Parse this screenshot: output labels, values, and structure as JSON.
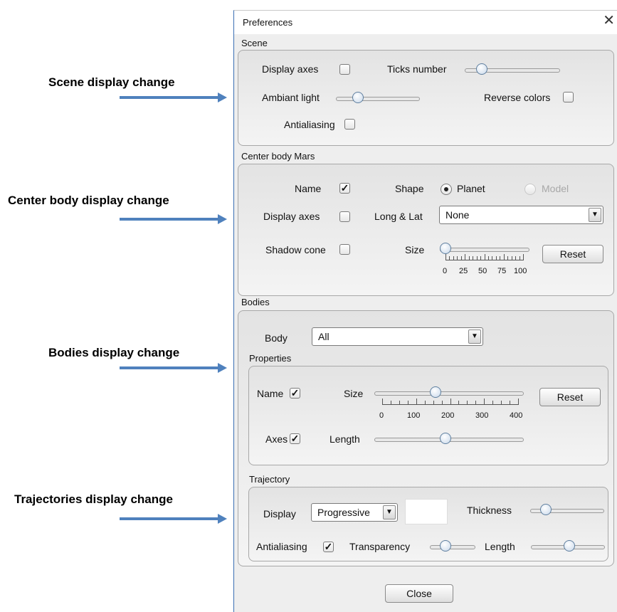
{
  "annotations": {
    "scene": "Scene display change",
    "center_body": "Center body display change",
    "bodies": "Bodies display change",
    "trajectories": "Trajectories display change"
  },
  "dialog": {
    "title": "Preferences"
  },
  "scene": {
    "header": "Scene",
    "display_axes": "Display axes",
    "ticks_number": "Ticks number",
    "ambiant_light": "Ambiant light",
    "reverse_colors": "Reverse colors",
    "antialiasing": "Antialiasing"
  },
  "center_body": {
    "header": "Center body Mars",
    "name": "Name",
    "shape": "Shape",
    "planet": "Planet",
    "model": "Model",
    "display_axes": "Display axes",
    "long_lat": "Long & Lat",
    "long_lat_value": "None",
    "shadow_cone": "Shadow cone",
    "size": "Size",
    "size_ticks": [
      "0",
      "25",
      "50",
      "75",
      "100"
    ],
    "size_value": 0,
    "reset": "Reset"
  },
  "bodies": {
    "header": "Bodies",
    "body_label": "Body",
    "body_value": "All",
    "properties_header": "Properties",
    "name": "Name",
    "size": "Size",
    "size_ticks": [
      "0",
      "100",
      "200",
      "300",
      "400"
    ],
    "size_value": 160,
    "reset": "Reset",
    "axes": "Axes",
    "length": "Length"
  },
  "trajectory": {
    "header": "Trajectory",
    "display": "Display",
    "display_value": "Progressive",
    "thickness": "Thickness",
    "antialiasing": "Antialiasing",
    "transparency": "Transparency",
    "length": "Length"
  },
  "close": "Close",
  "arrow_color": "#4f81bd"
}
